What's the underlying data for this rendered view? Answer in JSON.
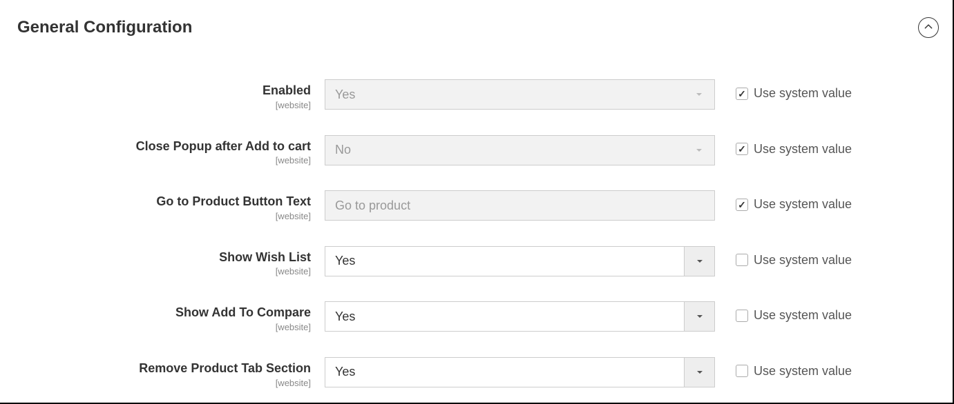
{
  "section_title": "General Configuration",
  "use_system_value_label": "Use system value",
  "fields": [
    {
      "label": "Enabled",
      "scope": "[website]",
      "type": "select",
      "value": "Yes",
      "disabled": true,
      "use_system_checked": true
    },
    {
      "label": "Close Popup after Add to cart",
      "scope": "[website]",
      "type": "select",
      "value": "No",
      "disabled": true,
      "use_system_checked": true
    },
    {
      "label": "Go to Product Button Text",
      "scope": "[website]",
      "type": "text",
      "value": "Go to product",
      "disabled": true,
      "use_system_checked": true
    },
    {
      "label": "Show Wish List",
      "scope": "[website]",
      "type": "select",
      "value": "Yes",
      "disabled": false,
      "use_system_checked": false
    },
    {
      "label": "Show Add To Compare",
      "scope": "[website]",
      "type": "select",
      "value": "Yes",
      "disabled": false,
      "use_system_checked": false
    },
    {
      "label": "Remove Product Tab Section",
      "scope": "[website]",
      "type": "select",
      "value": "Yes",
      "disabled": false,
      "use_system_checked": false
    }
  ]
}
